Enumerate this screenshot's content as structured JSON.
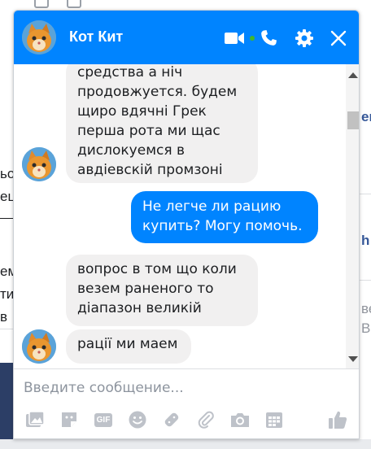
{
  "background": {
    "fragments": [
      "ьо",
      "ец",
      "ем",
      "ти",
      "в",
      "ен",
      "h",
      "ве",
      "Вь"
    ]
  },
  "chat": {
    "contact_name": "Кот Кит",
    "header_icons": [
      "video-camera-icon",
      "phone-icon",
      "gear-icon",
      "close-icon"
    ],
    "messages": [
      {
        "direction": "incoming",
        "text": "средства а ніч\nпродовжуется. будем\nщиро вдячні Грек\nперша рота ми щас\nдислокуемся в\nавдіевскій промзоні"
      },
      {
        "direction": "outgoing",
        "text": "Не легче ли рацию\nкупить? Могу помочь."
      },
      {
        "direction": "incoming",
        "text": "вопрос в том що коли\nвезем раненого то\nдіапазон великій"
      },
      {
        "direction": "incoming",
        "text": "рації ми маем"
      }
    ],
    "composer": {
      "placeholder": "Введите сообщение...",
      "tools": [
        "photo-icon",
        "sticker-icon",
        "gif-icon",
        "emoji-icon",
        "games-icon",
        "attach-icon",
        "camera-icon",
        "plan-icon",
        "thumbs-up-icon"
      ],
      "gif_label": "GIF"
    }
  },
  "colors": {
    "header": "#0084ff",
    "outgoing_bubble": "#0084ff",
    "incoming_bubble": "#f1f0f0",
    "icon_grey": "#bec2c9"
  }
}
